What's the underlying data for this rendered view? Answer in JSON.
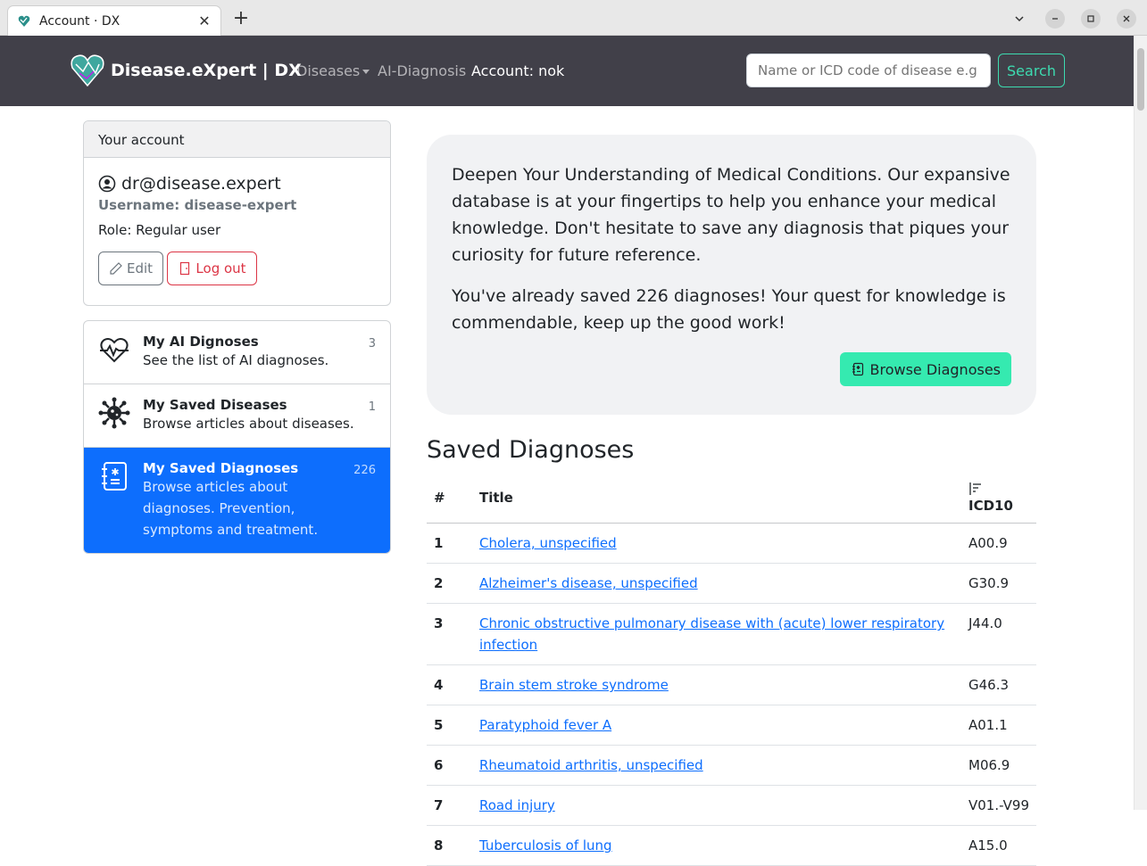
{
  "browser": {
    "tab_title": "Account · DX",
    "new_tab_label": "+",
    "close_label": "✕"
  },
  "navbar": {
    "brand": "Disease.eXpert | DX",
    "links": [
      "Diseases",
      "AI-Diagnosis",
      "Account: nok"
    ],
    "search_placeholder": "Name or ICD code of disease e.g",
    "search_button": "Search"
  },
  "account": {
    "header": "Your account",
    "email": "dr@disease.expert",
    "username": "Username: disease-expert",
    "role": "Role: Regular user",
    "edit_label": "Edit",
    "logout_label": "Log out"
  },
  "sidebar": {
    "items": [
      {
        "title": "My AI Dignoses",
        "desc": "See the list of AI diagnoses.",
        "count": "3",
        "icon": "heart-pulse-icon"
      },
      {
        "title": "My Saved Diseases",
        "desc": "Browse articles about diseases.",
        "count": "1",
        "icon": "virus-icon"
      },
      {
        "title": "My Saved Diagnoses",
        "desc": "Browse articles about diagnoses. Prevention, symptoms and treatment.",
        "count": "226",
        "icon": "journal-medical-icon",
        "active": true
      }
    ]
  },
  "intro": {
    "paragraph1": "Deepen Your Understanding of Medical Conditions. Our expansive database is at your fingertips to help you enhance your medical knowledge. Don't hesitate to save any diagnosis that piques your curiosity for future reference.",
    "paragraph2": "You've already saved 226 diagnoses! Your quest for knowledge is commendable, keep up the good work!",
    "browse_button": "Browse Diagnoses"
  },
  "saved": {
    "title": "Saved Diagnoses",
    "columns": [
      "#",
      "Title",
      "ICD10"
    ],
    "rows": [
      {
        "num": "1",
        "title": "Cholera, unspecified",
        "icd": "A00.9"
      },
      {
        "num": "2",
        "title": "Alzheimer's disease, unspecified",
        "icd": "G30.9"
      },
      {
        "num": "3",
        "title": "Chronic obstructive pulmonary disease with (acute) lower respiratory infection",
        "icd": "J44.0"
      },
      {
        "num": "4",
        "title": "Brain stem stroke syndrome",
        "icd": "G46.3"
      },
      {
        "num": "5",
        "title": "Paratyphoid fever A",
        "icd": "A01.1"
      },
      {
        "num": "6",
        "title": "Rheumatoid arthritis, unspecified",
        "icd": "M06.9"
      },
      {
        "num": "7",
        "title": "Road injury",
        "icd": "V01.-V99"
      },
      {
        "num": "8",
        "title": "Tuberculosis of lung",
        "icd": "A15.0"
      }
    ]
  },
  "colors": {
    "navbar_bg": "#414049",
    "accent": "#35eab0",
    "primary": "#0d6efd",
    "danger": "#dc3545"
  }
}
